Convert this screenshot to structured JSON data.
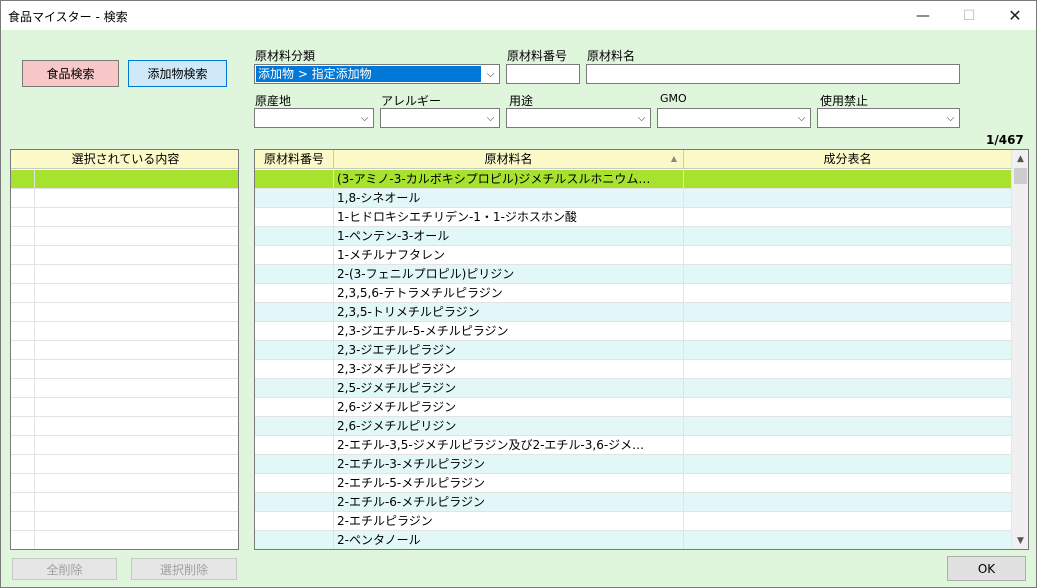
{
  "window": {
    "title": "食品マイスター - 検索",
    "min": "—",
    "max": "☐",
    "close": "✕"
  },
  "buttons": {
    "food_search": "食品検索",
    "additive_search": "添加物検索",
    "clear_all": "全削除",
    "delete_selected": "選択削除",
    "ok": "OK"
  },
  "filters": {
    "category_label": "原材料分類",
    "category_value": "添加物 > 指定添加物",
    "number_label": "原材料番号",
    "number_value": "",
    "name_label": "原材料名",
    "name_value": "",
    "origin_label": "原産地",
    "allergy_label": "アレルギー",
    "usage_label": "用途",
    "gmo_label": "GMO",
    "prohibited_label": "使用禁止"
  },
  "count": "1/467",
  "selected_panel": {
    "header": "選択されている内容"
  },
  "results": {
    "columns": [
      "原材料番号",
      "原材料名",
      "成分表名"
    ],
    "sort_indicator": "▲",
    "rows": [
      "(3-アミノ-3-カルボキシプロピル)ジメチルスルホニウム…",
      "1,8-シネオール",
      "1-ヒドロキシエチリデン-1・1-ジホスホン酸",
      "1-ペンテン-3-オール",
      "1-メチルナフタレン",
      "2-(3-フェニルプロピル)ピリジン",
      "2,3,5,6-テトラメチルピラジン",
      "2,3,5-トリメチルピラジン",
      "2,3-ジエチル-5-メチルピラジン",
      "2,3-ジエチルピラジン",
      "2,3-ジメチルピラジン",
      "2,5-ジメチルピラジン",
      "2,6-ジメチルピラジン",
      "2,6-ジメチルピリジン",
      "2-エチル-3,5-ジメチルピラジン及び2-エチル-3,6-ジメ…",
      "2-エチル-3-メチルピラジン",
      "2-エチル-5-メチルピラジン",
      "2-エチル-6-メチルピラジン",
      "2-エチルピラジン",
      "2-ペンタノール"
    ]
  },
  "colors": {
    "background": "#dff5dc",
    "header": "#fbf9c8",
    "selected_row": "#a6e22e",
    "alt_row": "#e2f7f8"
  },
  "icons": {
    "dropdown": "chevron-down-icon",
    "scroll_up": "up-arrow-icon",
    "scroll_down": "down-arrow-icon"
  }
}
